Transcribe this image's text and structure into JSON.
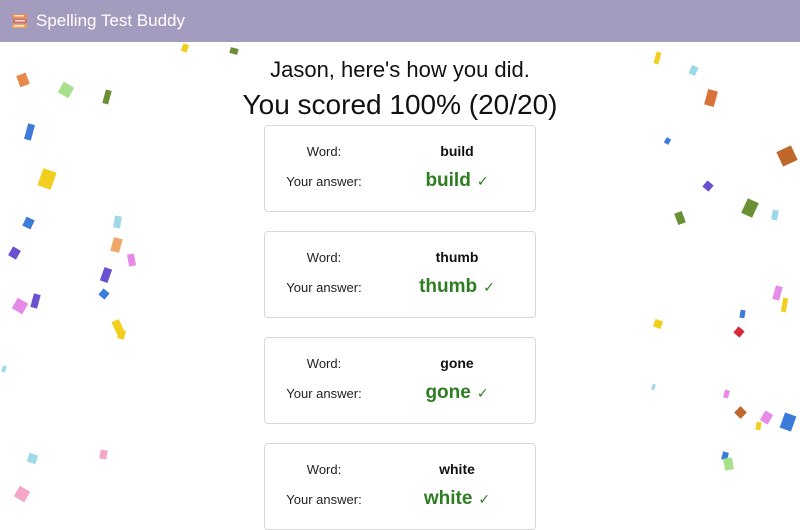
{
  "app": {
    "title": "Spelling Test Buddy",
    "logo_icon": "stacked-books-icon",
    "bar_color": "#a39cbe"
  },
  "results": {
    "greeting": "Jason, here's how you did.",
    "score": "You scored 100% (20/20)",
    "word_label": "Word:",
    "answer_label": "Your answer:",
    "correct_color": "#2e7d22",
    "items": [
      {
        "word": "build",
        "answer": "build",
        "mark": "✓"
      },
      {
        "word": "thumb",
        "answer": "thumb",
        "mark": "✓"
      },
      {
        "word": "gone",
        "answer": "gone",
        "mark": "✓"
      },
      {
        "word": "white",
        "answer": "white",
        "mark": "✓"
      }
    ]
  }
}
